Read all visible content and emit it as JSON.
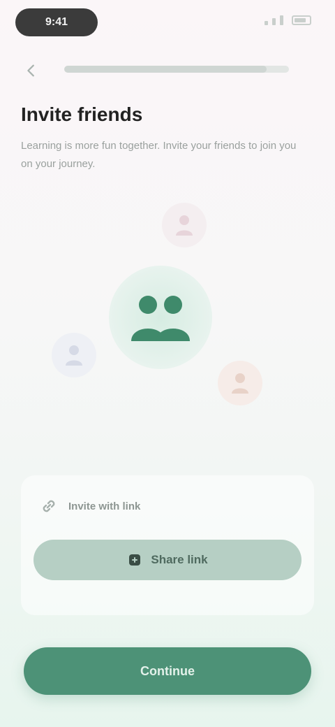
{
  "status_bar": {
    "time": "9:41"
  },
  "progress": {
    "value": 0.9
  },
  "header": {
    "title": "Invite friends",
    "subtitle": "Learning is more fun together. Invite your friends to join you on your journey."
  },
  "invite": {
    "label": "Invite with link",
    "share_button_label": "Share link"
  },
  "footer": {
    "continue_label": "Continue"
  },
  "icons": {
    "back": "back-arrow-icon",
    "link": "link-icon",
    "share": "share-icon",
    "people": "people-group-icon"
  },
  "colors": {
    "accent": "#4d9277",
    "accent_light": "#b6cfc4",
    "people_fill": "#3f8a6b"
  }
}
